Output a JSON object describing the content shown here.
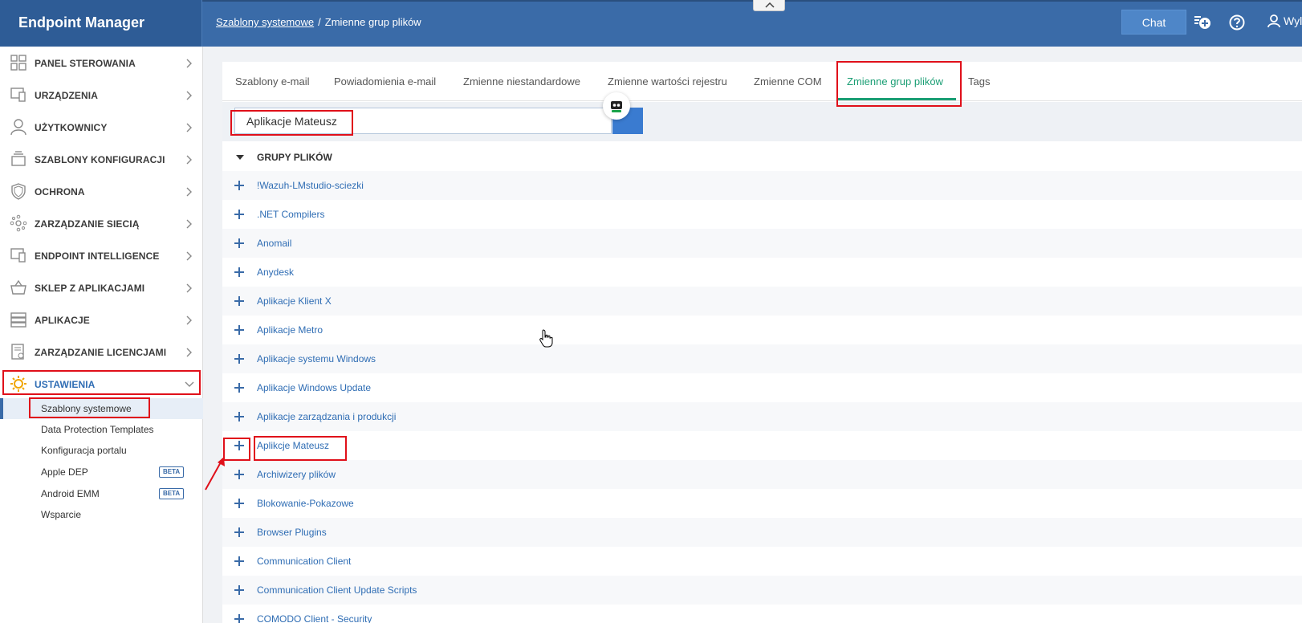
{
  "app": {
    "title": "Endpoint Manager"
  },
  "breadcrumb": {
    "parent": "Szablony systemowe",
    "separator": "/",
    "current": "Zmienne grup plików"
  },
  "header": {
    "chat_label": "Chat",
    "user_label": "Wyl"
  },
  "sidebar": {
    "items": [
      {
        "label": "PANEL STEROWANIA",
        "icon": "dashboard-icon"
      },
      {
        "label": "URZĄDZENIA",
        "icon": "devices-icon"
      },
      {
        "label": "UŻYTKOWNICY",
        "icon": "user-icon"
      },
      {
        "label": "SZABLONY KONFIGURACJI",
        "icon": "templates-icon"
      },
      {
        "label": "OCHRONA",
        "icon": "shield-icon"
      },
      {
        "label": "ZARZĄDZANIE SIECIĄ",
        "icon": "network-icon"
      },
      {
        "label": "ENDPOINT INTELLIGENCE",
        "icon": "intelligence-icon"
      },
      {
        "label": "SKLEP Z APLIKACJAMI",
        "icon": "basket-icon"
      },
      {
        "label": "APLIKACJE",
        "icon": "applications-icon"
      },
      {
        "label": "ZARZĄDZANIE LICENCJAMI",
        "icon": "license-icon"
      },
      {
        "label": "USTAWIENIA",
        "icon": "gear-icon"
      }
    ],
    "sub_items": [
      {
        "label": "Szablony systemowe"
      },
      {
        "label": "Data Protection Templates"
      },
      {
        "label": "Konfiguracja portalu"
      },
      {
        "label": "Apple DEP",
        "badge": "BETA"
      },
      {
        "label": "Android EMM",
        "badge": "BETA"
      },
      {
        "label": "Wsparcie"
      }
    ]
  },
  "tabs": [
    {
      "label": "Szablony e-mail"
    },
    {
      "label": "Powiadomienia e-mail"
    },
    {
      "label": "Zmienne niestandardowe"
    },
    {
      "label": "Zmienne wartości rejestru"
    },
    {
      "label": "Zmienne COM"
    },
    {
      "label": "Zmienne grup plików"
    },
    {
      "label": "Tags"
    }
  ],
  "search": {
    "value": "Aplikacje Mateusz"
  },
  "group": {
    "header": "GRUPY PLIKÓW",
    "rows": [
      "!Wazuh-LMstudio-sciezki",
      ".NET Compilers",
      "Anomail",
      "Anydesk",
      "Aplikacje Klient X",
      "Aplikacje Metro",
      "Aplikacje systemu Windows",
      "Aplikacje Windows Update",
      "Aplikacje zarządzania i produkcji",
      "Aplikcje Mateusz",
      "Archiwizery plików",
      "Blokowanie-Pokazowe",
      "Browser Plugins",
      "Communication Client",
      "Communication Client Update Scripts",
      "COMODO Client - Security"
    ]
  },
  "colors": {
    "header": "#3a6ba8",
    "accent": "#1a9e74",
    "link": "#2f6db4",
    "annotation": "#e0101a"
  }
}
